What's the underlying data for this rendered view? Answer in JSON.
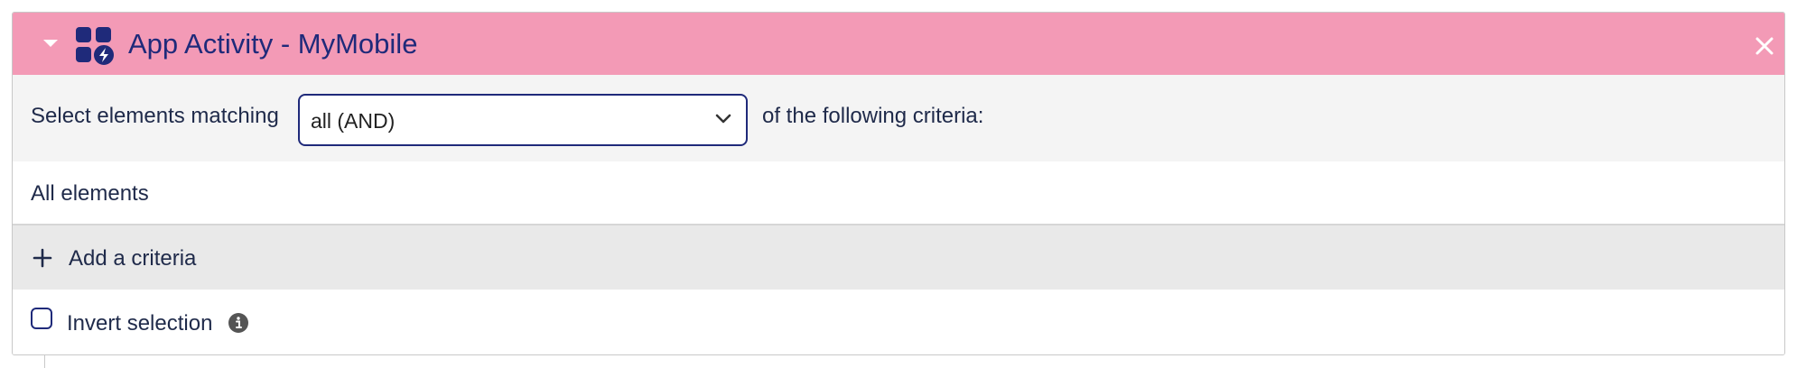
{
  "header": {
    "title": "App Activity - MyMobile",
    "background_color": "#f39ab6",
    "title_color": "#1f2a7a",
    "collapse_icon": "caret-down-icon",
    "app_icon": "app-activity-icon",
    "close_icon": "close-icon"
  },
  "match": {
    "prefix_label": "Select elements matching",
    "selected_value": "all (AND)",
    "suffix_label": "of the following criteria:"
  },
  "criteria": {
    "summary": "All elements"
  },
  "add_criteria": {
    "label": "Add a criteria",
    "icon": "plus-icon"
  },
  "invert": {
    "label": "Invert selection",
    "checked": false,
    "info_icon": "info-icon"
  }
}
